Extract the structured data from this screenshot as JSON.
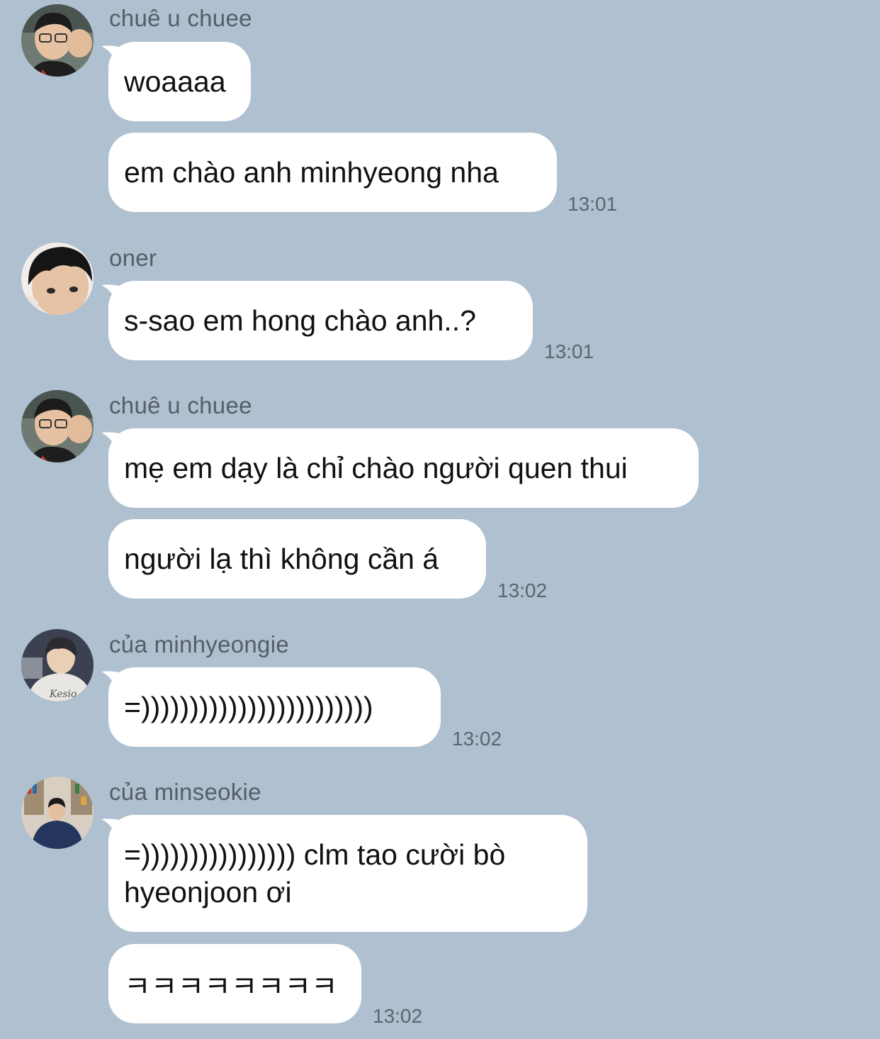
{
  "colors": {
    "background": "#afc0d0",
    "bubble": "#ffffff",
    "text": "#111111",
    "meta_text": "#565e66"
  },
  "messages": [
    {
      "sender": "chuê u chuee",
      "avatar": "avatar-chuee",
      "bubbles": [
        "woaaaa",
        "em chào anh minhyeong nha"
      ],
      "time": "13:01"
    },
    {
      "sender": "oner",
      "avatar": "avatar-oner",
      "bubbles": [
        "s-sao em hong chào anh..?"
      ],
      "time": "13:01"
    },
    {
      "sender": "chuê u chuee",
      "avatar": "avatar-chuee",
      "bubbles": [
        "mẹ em dạy là chỉ chào người quen thui",
        "người lạ thì không cần á"
      ],
      "time": "13:02"
    },
    {
      "sender": "của minhyeongie",
      "avatar": "avatar-minhyeongie",
      "bubbles": [
        "=))))))))))))))))))))))))"
      ],
      "time": "13:02"
    },
    {
      "sender": "của minseokie",
      "avatar": "avatar-minseokie",
      "bubbles": [
        "=)))))))))))))))) clm tao cười bò hyeonjoon ơi",
        "ㅋㅋㅋㅋㅋㅋㅋㅋ"
      ],
      "time": "13:02"
    }
  ]
}
